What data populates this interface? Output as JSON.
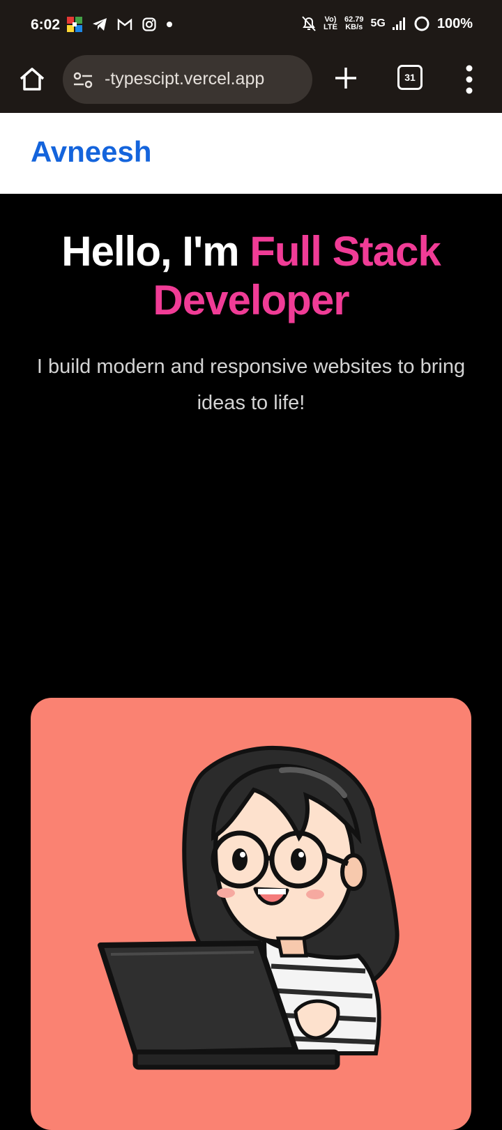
{
  "status_bar": {
    "time": "6:02",
    "left_icons": [
      "ludo-game-icon",
      "telegram-icon",
      "gmail-icon",
      "instagram-icon",
      "notification-dot-icon"
    ],
    "volte": "Vo)",
    "lte": "LTE",
    "speed_value": "62.79",
    "speed_unit": "KB/s",
    "network": "5G",
    "battery": "100%",
    "right_icons": [
      "mute-bell-icon",
      "signal-icon",
      "battery-ring-icon"
    ]
  },
  "browser": {
    "url": "-typescipt.vercel.app",
    "tab_count": "31",
    "icons": [
      "home-icon",
      "site-settings-icon",
      "new-tab-plus-icon",
      "tab-switcher-icon",
      "more-menu-icon"
    ]
  },
  "header": {
    "brand": "Avneesh",
    "brand_color": "#1464dc"
  },
  "hero": {
    "title_prefix": "Hello, I'm",
    "title_accent": "Full Stack Developer",
    "subtitle": "I build modern and responsive websites to bring ideas to life!",
    "accent_color": "#f03c96"
  },
  "card": {
    "background": "#fa8272",
    "illustration": "girl-with-glasses-using-laptop-illustration"
  }
}
